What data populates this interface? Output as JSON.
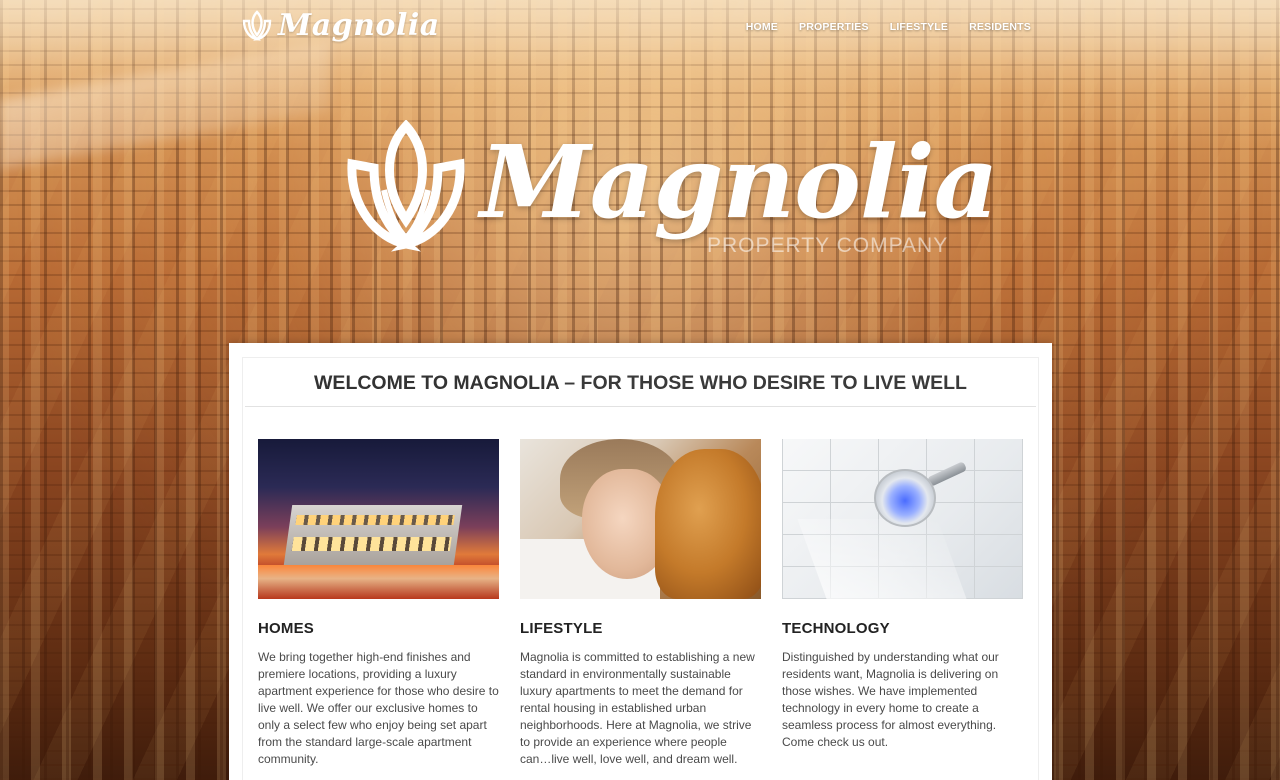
{
  "brand": {
    "logo_text": "Magnolia"
  },
  "nav": {
    "items": [
      {
        "label": "HOME"
      },
      {
        "label": "PROPERTIES"
      },
      {
        "label": "LIFESTYLE"
      },
      {
        "label": "RESIDENTS"
      }
    ]
  },
  "hero": {
    "title": "Magnolia",
    "subtitle": "PROPERTY COMPANY"
  },
  "welcome": {
    "bold": "WELCOME TO MAGNOLIA",
    "rest": " – FOR THOSE WHO DESIRE TO LIVE WELL"
  },
  "columns": [
    {
      "heading": "HOMES",
      "text": "We bring together high-end finishes and premiere locations, providing a luxury apartment experience for those who desire to live well.  We offer our exclusive homes to only a select few who enjoy being set apart from the standard large-scale apartment community."
    },
    {
      "heading": "LIFESTYLE",
      "text": "Magnolia is committed to establishing a new standard in environmentally sustainable luxury apartments to meet the demand for rental housing in established urban neighborhoods.  Here at Magnolia, we strive to provide an experience where people can…live well, love well, and dream well."
    },
    {
      "heading": "TECHNOLOGY",
      "text": "Distinguished by understanding what our residents want, Magnolia is delivering on those wishes.  We have implemented technology in every home to create a seamless process for almost everything. Come check us out."
    }
  ],
  "icons": {
    "logo": "magnolia-flower-icon"
  },
  "colors": {
    "text_dark": "#333333",
    "body_text": "#4a4a4a",
    "nav_text": "#ffffff",
    "card_bg": "#ffffff"
  }
}
